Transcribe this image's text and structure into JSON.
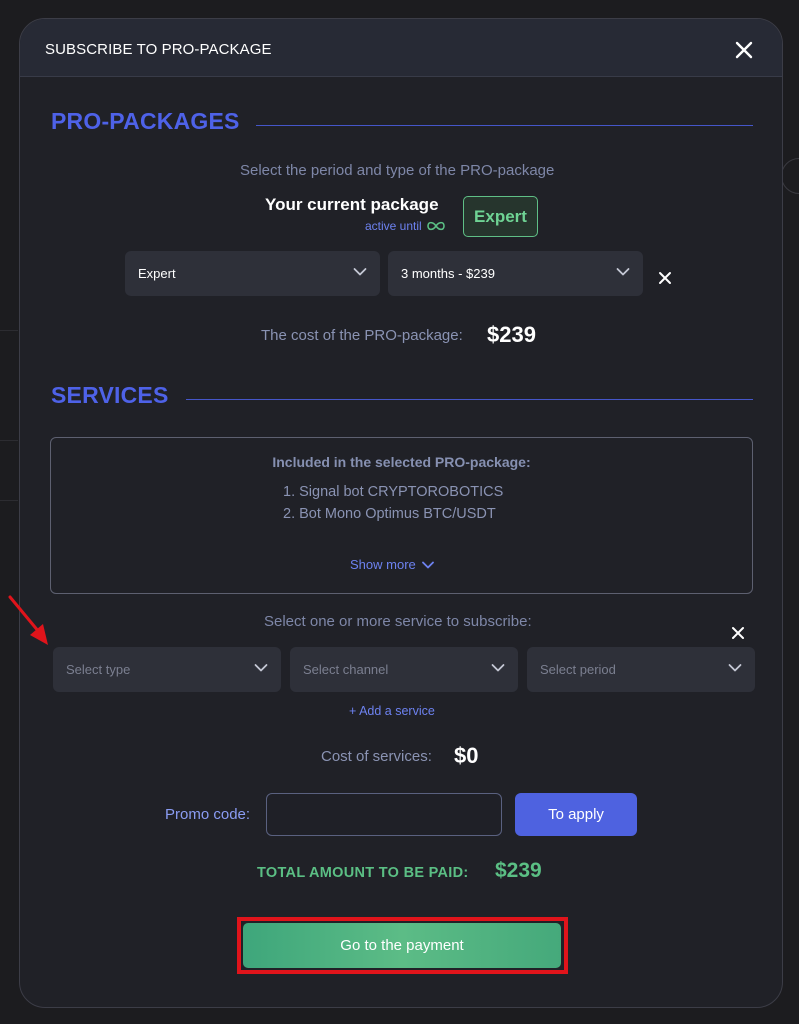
{
  "modal": {
    "title": "SUBSCRIBE TO PRO-PACKAGE"
  },
  "pro_packages": {
    "heading": "PRO-PACKAGES",
    "subtitle": "Select the period and type of the PRO-package",
    "current_package_label": "Your current package",
    "active_until_label": "active until",
    "current_package_badge": "Expert",
    "type_select_value": "Expert",
    "period_select_value": "3 months - $239",
    "cost_label": "The cost of the PRO-package:",
    "cost_value": "$239"
  },
  "services": {
    "heading": "SERVICES",
    "included_title": "Included in the selected PRO-package:",
    "included_items": [
      "1.  Signal bot CRYPTOROBOTICS",
      "2.  Bot Mono Optimus BTC/USDT"
    ],
    "show_more_label": "Show more",
    "select_prompt": "Select one or more service to subscribe:",
    "type_placeholder": "Select type",
    "channel_placeholder": "Select channel",
    "period_placeholder": "Select period",
    "add_service_label": "+ Add a service",
    "cost_label": "Cost of services:",
    "cost_value": "$0"
  },
  "promo": {
    "label": "Promo code:",
    "value": "",
    "apply_label": "To apply"
  },
  "total": {
    "label": "TOTAL AMOUNT TO BE PAID:",
    "value": "$239"
  },
  "payment_button_label": "Go to the payment",
  "colors": {
    "accent_blue": "#4e62e8",
    "accent_green": "#5bbf84",
    "highlight_red": "#e0141b"
  },
  "icons": {
    "close": "close-icon",
    "chevron": "chevron-down-icon",
    "infinity": "infinity-icon",
    "annotation_arrow": "arrow-icon"
  }
}
